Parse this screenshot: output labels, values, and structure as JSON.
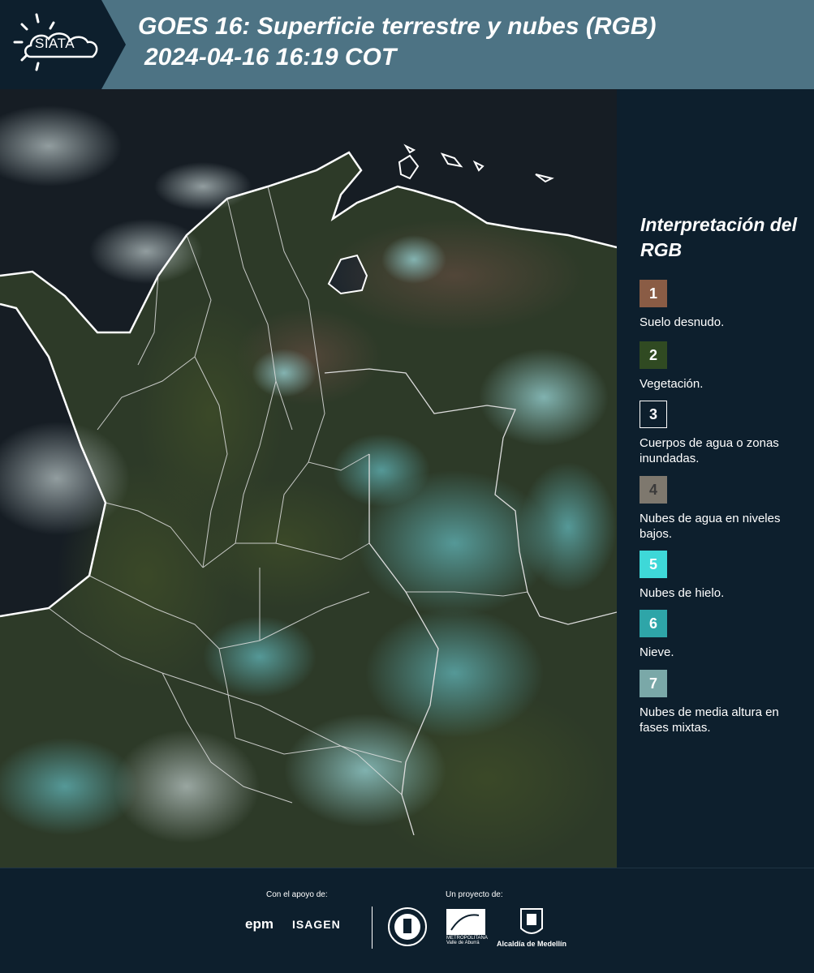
{
  "header": {
    "logo_text": "SIATA",
    "title_line1": "GOES 16: Superficie terrestre y nubes (RGB)",
    "title_line2": "2024-04-16 16:19 COT"
  },
  "legend": {
    "title": "Interpretación del RGB",
    "items": [
      {
        "number": "1",
        "label": "Suelo desnudo.",
        "color": "#8a5c45"
      },
      {
        "number": "2",
        "label": "Vegetación.",
        "color": "#304a22"
      },
      {
        "number": "3",
        "label": "Cuerpos de agua o zonas inundadas.",
        "color": "#0d1f2d"
      },
      {
        "number": "4",
        "label": "Nubes de agua en niveles bajos.",
        "color": "#7e786e"
      },
      {
        "number": "5",
        "label": "Nubes de hielo.",
        "color": "#3ed8d8"
      },
      {
        "number": "6",
        "label": "Nieve.",
        "color": "#2ea5a8"
      },
      {
        "number": "7",
        "label": "Nubes de media altura en fases mixtas.",
        "color": "#7aa8a8"
      }
    ]
  },
  "footer": {
    "support_label": "Con el apoyo de:",
    "project_label": "Un proyecto de:",
    "epm": "epm",
    "isagen": "ISAGEN",
    "area_text": "METROPOLITANA Valle de Aburrá",
    "alcaldia": "Alcaldía de Medellín"
  }
}
